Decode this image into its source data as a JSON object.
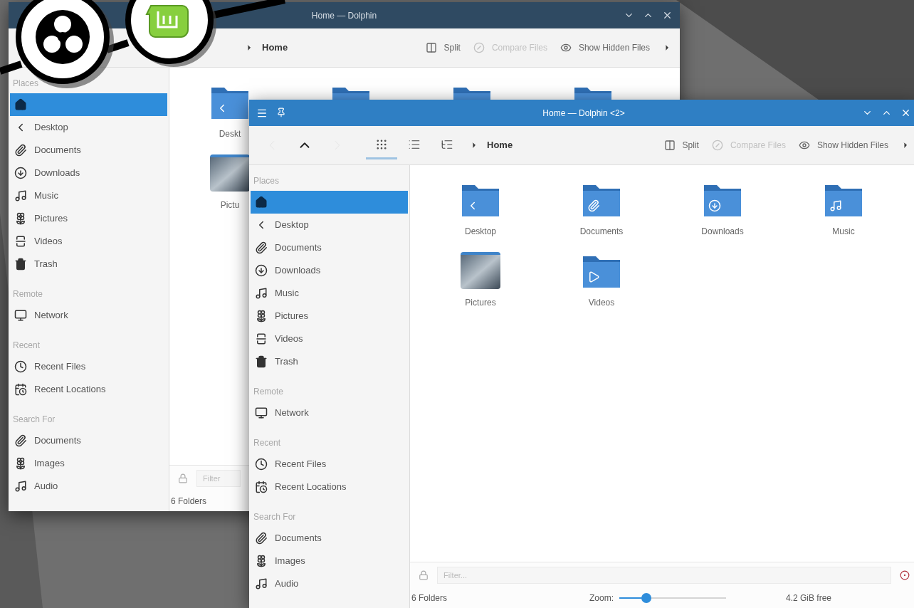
{
  "windows": [
    {
      "title": "Home — Dolphin",
      "active": false,
      "toolbar": {
        "breadcrumb": "Home",
        "actions": [
          {
            "kind": "split",
            "label": "Split",
            "disabled": false
          },
          {
            "kind": "compare",
            "label": "Compare Files",
            "disabled": true
          },
          {
            "kind": "hidden",
            "label": "Show Hidden Files",
            "disabled": false
          }
        ]
      },
      "sidebar": [
        {
          "heading": "Places",
          "items": [
            {
              "kind": "home",
              "selected": true
            },
            {
              "kind": "desktop",
              "label": "Desktop",
              "selected": false
            },
            {
              "kind": "documents",
              "label": "Documents",
              "selected": false
            },
            {
              "kind": "downloads",
              "label": "Downloads",
              "selected": false
            },
            {
              "kind": "music",
              "label": "Music",
              "selected": false
            },
            {
              "kind": "pictures",
              "label": "Pictures",
              "selected": false
            },
            {
              "kind": "videos",
              "label": "Videos",
              "selected": false
            },
            {
              "kind": "trash",
              "label": "Trash",
              "selected": false
            }
          ]
        },
        {
          "heading": "Remote",
          "items": [
            {
              "kind": "network",
              "label": "Network",
              "selected": false
            }
          ]
        },
        {
          "heading": "Recent",
          "items": [
            {
              "kind": "recent-files",
              "label": "Recent Files",
              "selected": false
            },
            {
              "kind": "recent-locations",
              "label": "Recent Locations",
              "selected": false
            }
          ]
        },
        {
          "heading": "Search For",
          "items": [
            {
              "kind": "documents",
              "label": "Documents",
              "selected": false
            },
            {
              "kind": "pictures",
              "label": "Images",
              "selected": false
            },
            {
              "kind": "music",
              "label": "Audio",
              "selected": false
            }
          ]
        }
      ],
      "content": [
        {
          "kind": "desktop",
          "label": "Deskt"
        },
        {
          "kind": "documents"
        },
        {
          "kind": "downloads"
        },
        {
          "kind": "music"
        },
        {
          "kind": "pictures",
          "label": "Pictu"
        }
      ],
      "filter": {
        "placeholder": "Filter"
      },
      "status": "6 Folders"
    },
    {
      "title": "Home — Dolphin <2>",
      "active": true,
      "toolbar": {
        "nav": [
          {
            "kind": "back",
            "disabled": true
          },
          {
            "kind": "up",
            "disabled": false
          },
          {
            "kind": "forward",
            "disabled": true
          }
        ],
        "view_modes": [
          {
            "kind": "icons",
            "selected": true
          },
          {
            "kind": "details",
            "selected": false
          },
          {
            "kind": "tree",
            "selected": false
          }
        ],
        "breadcrumb": "Home",
        "actions": [
          {
            "kind": "split",
            "label": "Split",
            "disabled": false
          },
          {
            "kind": "compare",
            "label": "Compare Files",
            "disabled": true
          },
          {
            "kind": "hidden",
            "label": "Show Hidden Files",
            "disabled": false
          }
        ]
      },
      "sidebar": [
        {
          "heading": "Places",
          "items": [
            {
              "kind": "home",
              "selected": true
            },
            {
              "kind": "desktop",
              "label": "Desktop",
              "selected": false
            },
            {
              "kind": "documents",
              "label": "Documents",
              "selected": false
            },
            {
              "kind": "downloads",
              "label": "Downloads",
              "selected": false
            },
            {
              "kind": "music",
              "label": "Music",
              "selected": false
            },
            {
              "kind": "pictures",
              "label": "Pictures",
              "selected": false
            },
            {
              "kind": "videos",
              "label": "Videos",
              "selected": false
            },
            {
              "kind": "trash",
              "label": "Trash",
              "selected": false
            }
          ]
        },
        {
          "heading": "Remote",
          "items": [
            {
              "kind": "network",
              "label": "Network",
              "selected": false
            }
          ]
        },
        {
          "heading": "Recent",
          "items": [
            {
              "kind": "recent-files",
              "label": "Recent Files",
              "selected": false
            },
            {
              "kind": "recent-locations",
              "label": "Recent Locations",
              "selected": false
            }
          ]
        },
        {
          "heading": "Search For",
          "items": [
            {
              "kind": "documents",
              "label": "Documents",
              "selected": false
            },
            {
              "kind": "pictures",
              "label": "Images",
              "selected": false
            },
            {
              "kind": "music",
              "label": "Audio",
              "selected": false
            }
          ]
        }
      ],
      "content": [
        {
          "kind": "desktop",
          "label": "Desktop"
        },
        {
          "kind": "documents",
          "label": "Documents"
        },
        {
          "kind": "downloads",
          "label": "Downloads"
        },
        {
          "kind": "music",
          "label": "Music"
        },
        {
          "kind": "pictures",
          "label": "Pictures"
        },
        {
          "kind": "videos",
          "label": "Videos"
        }
      ],
      "filter": {
        "placeholder": "Filter..."
      },
      "status": "6 Folders",
      "zoom": {
        "label": "Zoom:",
        "level": 0.25
      },
      "free_space": "4.2 GiB free"
    }
  ]
}
